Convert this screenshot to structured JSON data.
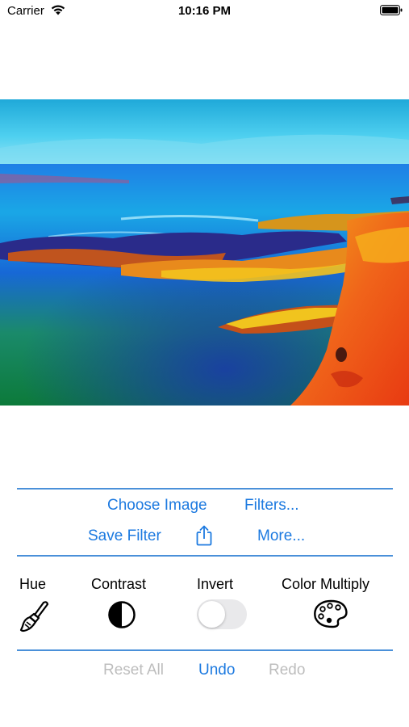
{
  "status_bar": {
    "carrier": "Carrier",
    "time": "10:16 PM",
    "wifi_icon": "wifi-icon",
    "battery_icon": "battery-icon"
  },
  "image": {
    "description_icon": "edited-photo"
  },
  "actions": {
    "choose_image": "Choose Image",
    "filters": "Filters...",
    "save_filter": "Save Filter",
    "share_icon": "share-icon",
    "more": "More..."
  },
  "controls": {
    "hue": {
      "label": "Hue",
      "icon": "paintbrush-icon"
    },
    "contrast": {
      "label": "Contrast",
      "icon": "contrast-circle-icon"
    },
    "invert": {
      "label": "Invert",
      "enabled": false
    },
    "color_multiply": {
      "label": "Color Multiply",
      "icon": "palette-icon"
    }
  },
  "history": {
    "reset_all": "Reset All",
    "undo": "Undo",
    "redo": "Redo"
  },
  "colors": {
    "accent": "#1d7ae0",
    "separator": "#4a90d9",
    "disabled": "#bdbdbd",
    "toggle_off": "#e9e9eb"
  }
}
